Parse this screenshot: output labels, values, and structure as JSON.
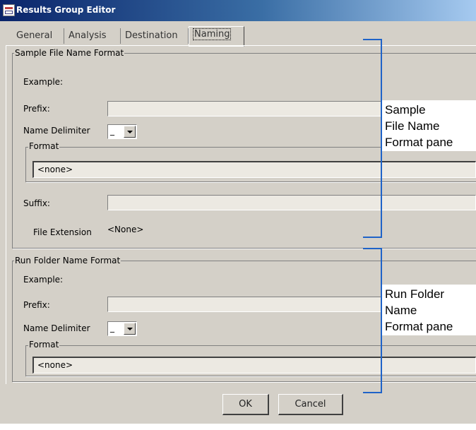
{
  "window": {
    "title": "Results Group Editor"
  },
  "tabs": [
    {
      "label": "General"
    },
    {
      "label": "Analysis"
    },
    {
      "label": "Destination"
    },
    {
      "label": "Naming"
    }
  ],
  "active_tab": "Naming",
  "sample_group": {
    "legend": "Sample File Name Format",
    "example_label": "Example:",
    "prefix_label": "Prefix:",
    "prefix_value": "",
    "delimiter_label": "Name Delimiter",
    "delimiter_value": "_",
    "format_legend": "Format",
    "format_value": "<none>",
    "suffix_label": "Suffix:",
    "suffix_value": "",
    "extension_label": "File Extension",
    "extension_value": "<None>"
  },
  "run_group": {
    "legend": "Run Folder Name Format",
    "example_label": "Example:",
    "prefix_label": "Prefix:",
    "prefix_value": "",
    "delimiter_label": "Name Delimiter",
    "delimiter_value": "_",
    "format_legend": "Format",
    "format_value": "<none>"
  },
  "buttons": {
    "ok": "OK",
    "cancel": "Cancel"
  },
  "callouts": {
    "sample": [
      "Sample",
      "File Name",
      "Format pane"
    ],
    "run": [
      "Run Folder",
      "Name",
      "Format pane"
    ]
  },
  "colors": {
    "bracket": "#1f63c8",
    "title_bar": "#0a246a"
  }
}
